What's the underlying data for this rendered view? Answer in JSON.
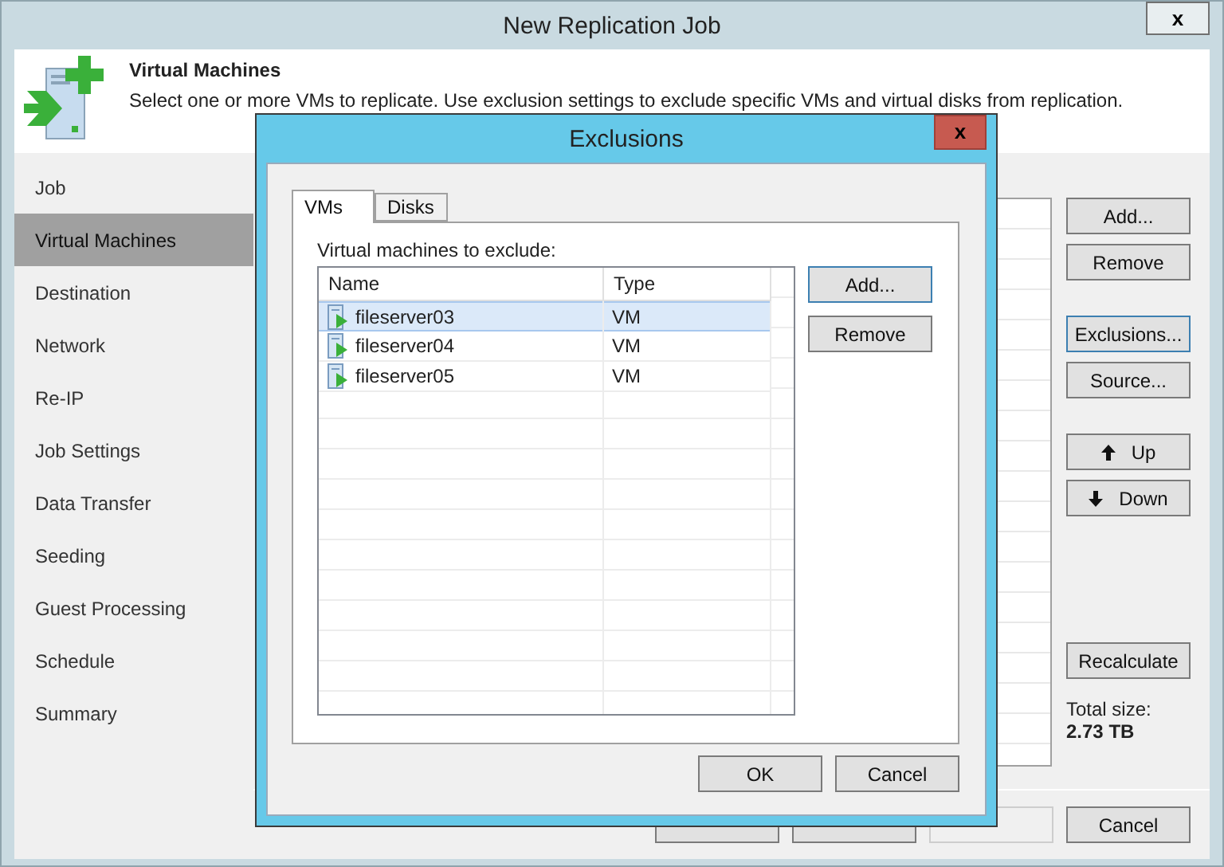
{
  "window": {
    "title": "New Replication Job",
    "close": "x"
  },
  "header": {
    "title": "Virtual Machines",
    "description": "Select one or more VMs to replicate. Use exclusion settings to exclude specific VMs and virtual disks from replication."
  },
  "sidebar": {
    "items": [
      {
        "label": "Job",
        "selected": false
      },
      {
        "label": "Virtual Machines",
        "selected": true
      },
      {
        "label": "Destination",
        "selected": false
      },
      {
        "label": "Network",
        "selected": false
      },
      {
        "label": "Re-IP",
        "selected": false
      },
      {
        "label": "Job Settings",
        "selected": false
      },
      {
        "label": "Data Transfer",
        "selected": false
      },
      {
        "label": "Seeding",
        "selected": false
      },
      {
        "label": "Guest Processing",
        "selected": false
      },
      {
        "label": "Schedule",
        "selected": false
      },
      {
        "label": "Summary",
        "selected": false
      }
    ]
  },
  "side_buttons": [
    {
      "label": "Add...",
      "kind": "plain",
      "focused": false
    },
    {
      "label": "Remove",
      "kind": "plain",
      "focused": false
    },
    {
      "label": "Exclusions...",
      "kind": "plain",
      "focused": true
    },
    {
      "label": "Source...",
      "kind": "plain",
      "focused": false
    },
    {
      "label": "Up",
      "kind": "up",
      "focused": false
    },
    {
      "label": "Down",
      "kind": "down",
      "focused": false
    },
    {
      "label": "Recalculate",
      "kind": "plain",
      "focused": false
    }
  ],
  "total": {
    "label": "Total size:",
    "value": "2.73 TB"
  },
  "footer_buttons": [
    {
      "disabled": false
    },
    {
      "disabled": false
    },
    {
      "disabled": true
    },
    {
      "label": "Cancel",
      "disabled": false
    }
  ],
  "dialog": {
    "title": "Exclusions",
    "close": "x",
    "tabs": [
      {
        "label": "VMs",
        "selected": true
      },
      {
        "label": "Disks",
        "selected": false
      }
    ],
    "list_label": "Virtual machines to exclude:",
    "columns": [
      "Name",
      "Type"
    ],
    "rows": [
      {
        "name": "fileserver03",
        "type": "VM",
        "selected": true
      },
      {
        "name": "fileserver04",
        "type": "VM",
        "selected": false
      },
      {
        "name": "fileserver05",
        "type": "VM",
        "selected": false
      }
    ],
    "buttons": [
      {
        "label": "Add...",
        "focused": true
      },
      {
        "label": "Remove",
        "focused": false
      }
    ],
    "footer_buttons": [
      "OK",
      "Cancel"
    ]
  }
}
